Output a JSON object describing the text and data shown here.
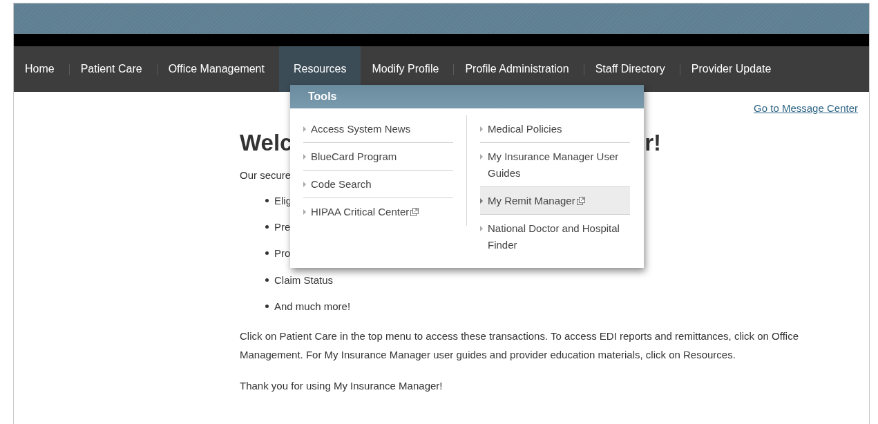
{
  "nav": {
    "items": [
      {
        "label": "Home",
        "selected": false
      },
      {
        "label": "Patient Care",
        "selected": false
      },
      {
        "label": "Office Management",
        "selected": false
      },
      {
        "label": "Resources",
        "selected": true
      },
      {
        "label": "Modify Profile",
        "selected": false
      },
      {
        "label": "Profile Administration",
        "selected": false
      },
      {
        "label": "Staff Directory",
        "selected": false
      },
      {
        "label": "Provider Update",
        "selected": false
      }
    ]
  },
  "menu": {
    "title": "Tools",
    "columns": [
      {
        "items": [
          {
            "label": "Access System News",
            "external": false,
            "selected": false
          },
          {
            "label": "BlueCard Program",
            "external": false,
            "selected": false
          },
          {
            "label": "Code Search",
            "external": false,
            "selected": false
          },
          {
            "label": "HIPAA Critical Center",
            "external": true,
            "selected": false
          }
        ]
      },
      {
        "items": [
          {
            "label": "Medical Policies",
            "external": false,
            "selected": false
          },
          {
            "label": "My Insurance Manager User Guides",
            "external": false,
            "selected": false
          },
          {
            "label": "My Remit Manager",
            "external": true,
            "selected": true
          },
          {
            "label": "National Doctor and Hospital Finder",
            "external": false,
            "selected": false
          }
        ]
      }
    ]
  },
  "message_link": "Go to Message Center",
  "welcome": {
    "heading_parts": [
      "Welc",
      "r!"
    ],
    "intro": "Our secure",
    "bullets": [
      "Elig",
      "Pre",
      "Pro",
      "Claim Status",
      "And much more!"
    ],
    "paragraphs": [
      "Click on Patient Care in the top menu to access these transactions. To access EDI reports and remittances, click on Office Management. For My Insurance Manager user guides and provider education materials, click on Resources.",
      "Thank you for using My Insurance Manager!"
    ]
  }
}
